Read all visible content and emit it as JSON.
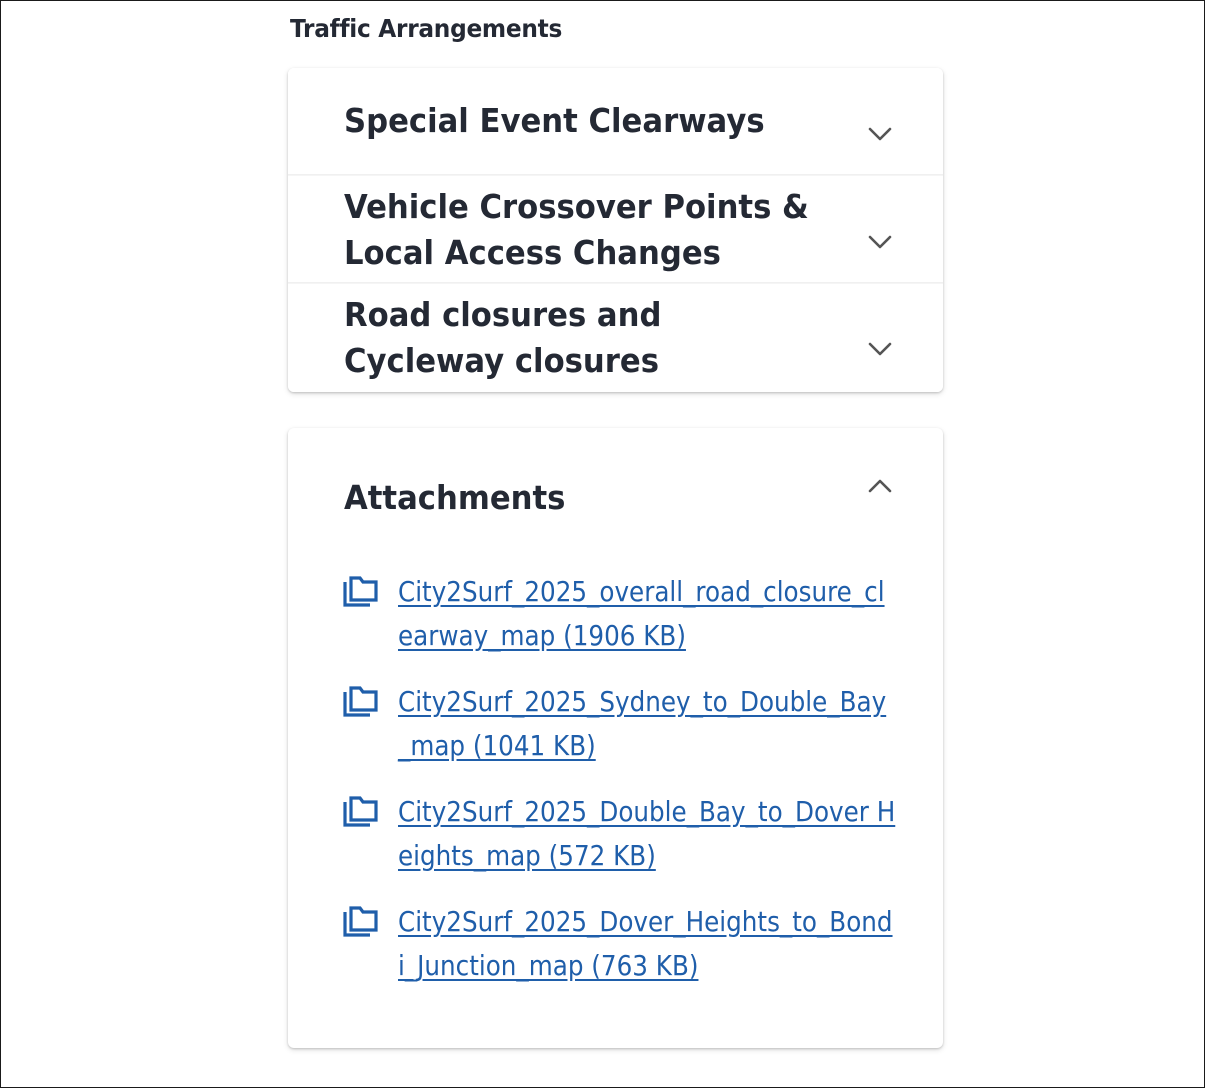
{
  "section": {
    "heading": "Traffic Arrangements"
  },
  "accordion": {
    "items": [
      {
        "title": "Special Event Clearways",
        "expanded": false
      },
      {
        "title": "Vehicle Crossover Points & Local Access Changes",
        "expanded": false
      },
      {
        "title": "Road closures and Cycleway closures",
        "expanded": false
      }
    ]
  },
  "attachments": {
    "title": "Attachments",
    "expanded": true,
    "files": [
      {
        "label": "City2Surf_2025_overall_road_closure_clearway_map (1906 KB)"
      },
      {
        "label": "City2Surf_2025_Sydney_to_Double_Bay_map (1041 KB)"
      },
      {
        "label": "City2Surf_2025_Double_Bay_to_Dover Heights_map (572 KB)"
      },
      {
        "label": "City2Surf_2025_Dover_Heights_to_Bondi_Junction_map (763 KB)"
      }
    ]
  },
  "colors": {
    "text": "#242934",
    "link": "#1f5eaa",
    "icon": "#1f5eaa",
    "chevron": "#555555"
  },
  "icons": {
    "accordion_toggle": "chevron-down-icon",
    "attachments_toggle": "chevron-up-icon",
    "file": "file-stack-icon"
  }
}
